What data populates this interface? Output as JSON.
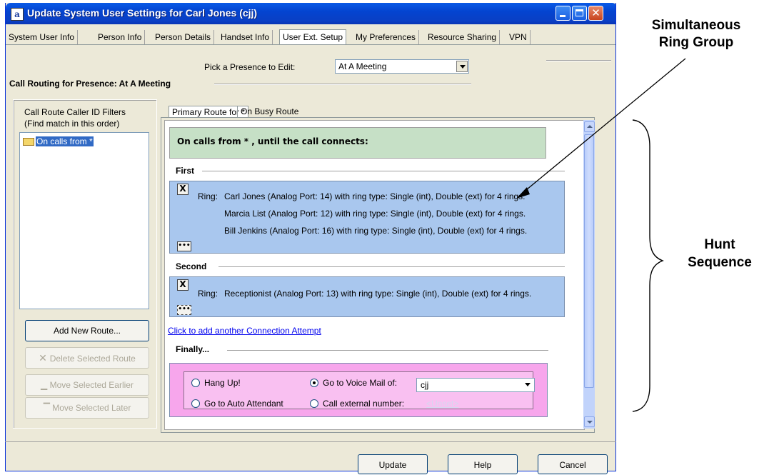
{
  "window": {
    "title": "Update System User Settings for Carl Jones (cjj)",
    "app_icon": "a",
    "controls": [
      "minimize-icon",
      "maximize-icon",
      "close-icon"
    ]
  },
  "tabs": [
    "System User Info",
    "Person Info",
    "Person Details",
    "Handset Info",
    "User Ext. Setup",
    "My Preferences",
    "Resource Sharing",
    "VPN"
  ],
  "active_tab": "User Ext. Setup",
  "presence": {
    "label": "Pick a Presence to Edit:",
    "selected": "At A Meeting",
    "section_title": "Call Routing for Presence: At A Meeting"
  },
  "filters": {
    "title_line1": "Call Route Caller ID Filters",
    "title_line2": "(Find match in this order)",
    "items": [
      "On calls from *"
    ],
    "buttons": {
      "add": "Add New Route...",
      "delete": "Delete Selected Route",
      "earlier": "Move Selected Earlier",
      "later": "Move Selected Later"
    }
  },
  "route_tabs": [
    "Primary Route for *",
    "On Busy Route"
  ],
  "route": {
    "header": "On calls from * , until the call connects:",
    "first_label": "First",
    "second_label": "Second",
    "ring_prefix": "Ring:",
    "first_rings": [
      "Carl Jones (Analog Port: 14) with ring type: Single (int), Double (ext) for 4 rings.",
      "Marcia List (Analog Port: 12) with ring type: Single (int), Double (ext) for 4 rings.",
      "Bill Jenkins (Analog Port: 16) with ring type: Single (int), Double (ext) for 4 rings."
    ],
    "second_rings": [
      "Receptionist (Analog Port: 13) with ring type: Single (int), Double (ext) for 4 rings."
    ],
    "x_label": "X",
    "dots_label": "•••",
    "add_link": "Click to add another Connection Attempt",
    "finally_label": "Finally...",
    "options": {
      "hang_up": "Hang Up!",
      "auto_attendant": "Go to Auto Attendant",
      "voice_mail": "Go to Voice Mail of:",
      "external": "Call external number:"
    },
    "selected_option": "voice_mail",
    "voice_mail_value": "cjj",
    "unset_link": "<Unset>"
  },
  "footer_buttons": [
    "Update",
    "Help",
    "Cancel"
  ],
  "annotations": {
    "simultaneous": [
      "Simultaneous",
      "Ring Group"
    ],
    "hunt": [
      "Hunt",
      "Sequence"
    ]
  }
}
